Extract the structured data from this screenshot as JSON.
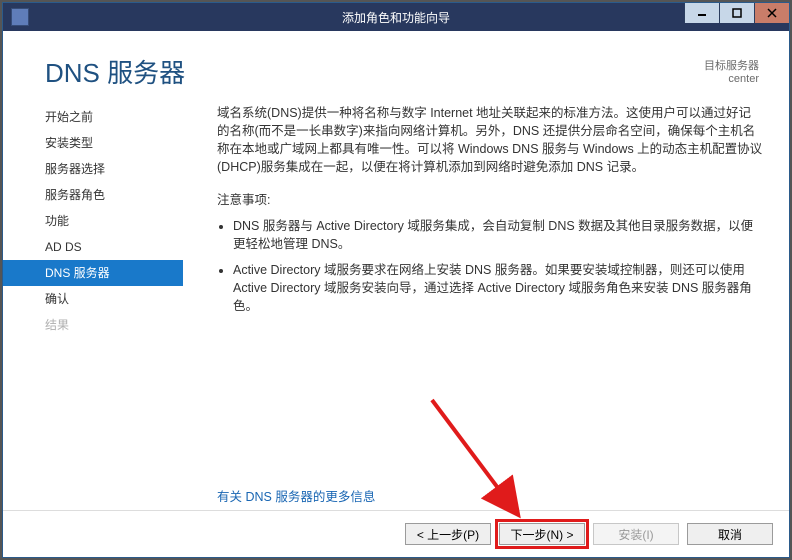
{
  "window": {
    "title": "添加角色和功能向导"
  },
  "header": {
    "title": "DNS 服务器",
    "target_label": "目标服务器",
    "target_value": "center"
  },
  "sidebar": {
    "items": [
      {
        "label": "开始之前",
        "state": "normal"
      },
      {
        "label": "安装类型",
        "state": "normal"
      },
      {
        "label": "服务器选择",
        "state": "normal"
      },
      {
        "label": "服务器角色",
        "state": "normal"
      },
      {
        "label": "功能",
        "state": "normal"
      },
      {
        "label": "AD DS",
        "state": "normal"
      },
      {
        "label": "DNS 服务器",
        "state": "active"
      },
      {
        "label": "确认",
        "state": "normal"
      },
      {
        "label": "结果",
        "state": "disabled"
      }
    ]
  },
  "content": {
    "description": "域名系统(DNS)提供一种将名称与数字 Internet 地址关联起来的标准方法。这使用户可以通过好记的名称(而不是一长串数字)来指向网络计算机。另外，DNS 还提供分层命名空间，确保每个主机名称在本地或广域网上都具有唯一性。可以将 Windows DNS 服务与 Windows 上的动态主机配置协议(DHCP)服务集成在一起，以便在将计算机添加到网络时避免添加 DNS 记录。",
    "notes_title": "注意事项:",
    "bullets": [
      "DNS 服务器与 Active Directory 域服务集成，会自动复制 DNS 数据及其他目录服务数据，以便更轻松地管理 DNS。",
      "Active Directory 域服务要求在网络上安装 DNS 服务器。如果要安装域控制器，则还可以使用 Active Directory 域服务安装向导，通过选择 Active Directory 域服务角色来安装 DNS 服务器角色。"
    ],
    "more_link": "有关 DNS 服务器的更多信息"
  },
  "footer": {
    "prev": "< 上一步(P)",
    "next": "下一步(N) >",
    "install": "安装(I)",
    "cancel": "取消"
  }
}
